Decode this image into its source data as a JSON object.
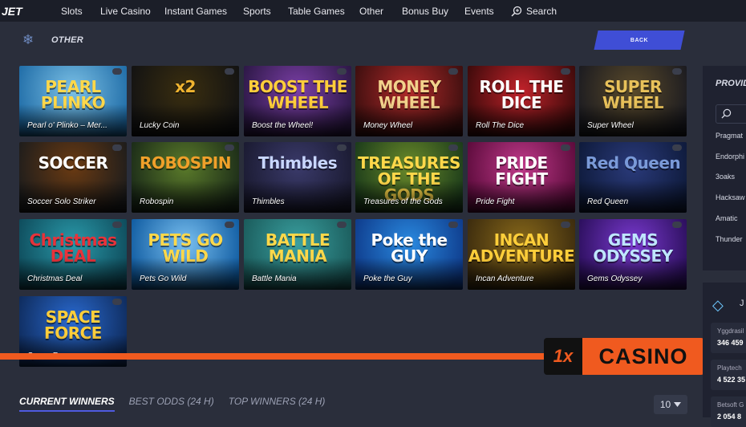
{
  "nav": {
    "logo": "JET",
    "items": [
      "Slots",
      "Live Casino",
      "Instant Games",
      "Sports",
      "Table Games",
      "Other",
      "Bonus Buy",
      "Events"
    ],
    "search_label": "Search"
  },
  "section": {
    "title": "OTHER",
    "back_label": "BACK",
    "icon": "snowflake-icon"
  },
  "games": [
    {
      "name": "Pearl o' Plinko – Mer...",
      "art": "PEARL PLINKO",
      "bg1": "#1e6ba6",
      "bg2": "#7cc1e6",
      "fg": "#ffd84a"
    },
    {
      "name": "Lucky Coin",
      "art": "x2",
      "bg1": "#121212",
      "bg2": "#3a2e10",
      "fg": "#f0b430"
    },
    {
      "name": "Boost the Wheel!",
      "art": "BOOST THE WHEEL",
      "bg1": "#2b1744",
      "bg2": "#7b3fa6",
      "fg": "#ffce3a"
    },
    {
      "name": "Money Wheel",
      "art": "MONEY WHEEL",
      "bg1": "#3a0e0e",
      "bg2": "#b02a2a",
      "fg": "#f2d28c"
    },
    {
      "name": "Roll The Dice",
      "art": "ROLL THE DICE",
      "bg1": "#3a0a0a",
      "bg2": "#c0222a",
      "fg": "#ffffff"
    },
    {
      "name": "Super Wheel",
      "art": "SUPER WHEEL",
      "bg1": "#1a1a20",
      "bg2": "#5a4a2a",
      "fg": "#e8c15a"
    },
    {
      "name": "Soccer Solo Striker",
      "art": "SOCCER",
      "bg1": "#1c1c1c",
      "bg2": "#6a3a12",
      "fg": "#ffffff"
    },
    {
      "name": "Robospin",
      "art": "ROBOSPIN",
      "bg1": "#1a2a18",
      "bg2": "#5a7a2a",
      "fg": "#f0a02a"
    },
    {
      "name": "Thimbles",
      "art": "Thimbles",
      "bg1": "#1a1a30",
      "bg2": "#3a3a6a",
      "fg": "#c8d6ff"
    },
    {
      "name": "Treasures of the Gods",
      "art": "TREASURES OF THE GODS",
      "bg1": "#1a3a1a",
      "bg2": "#6a8a2a",
      "fg": "#ffd84a"
    },
    {
      "name": "Pride Fight",
      "art": "PRIDE FIGHT",
      "bg1": "#5a0a3a",
      "bg2": "#c03a8a",
      "fg": "#ffffff"
    },
    {
      "name": "Red Queen",
      "art": "Red Queen",
      "bg1": "#0e1a3a",
      "bg2": "#2a3a7a",
      "fg": "#7a9ad8"
    },
    {
      "name": "Christmas Deal",
      "art": "Christmas DEAL",
      "bg1": "#0e4a5a",
      "bg2": "#2a9aaa",
      "fg": "#e8323a"
    },
    {
      "name": "Pets Go Wild",
      "art": "PETS GO WILD",
      "bg1": "#0e5aa0",
      "bg2": "#7ac0f0",
      "fg": "#ffd84a"
    },
    {
      "name": "Battle Mania",
      "art": "BATTLE MANIA",
      "bg1": "#1a5a5a",
      "bg2": "#3aa0a0",
      "fg": "#ffd84a"
    },
    {
      "name": "Poke the Guy",
      "art": "Poke the GUY",
      "bg1": "#0e3a8a",
      "bg2": "#2a8ae0",
      "fg": "#ffffff"
    },
    {
      "name": "Incan Adventure",
      "art": "INCAN ADVENTURE",
      "bg1": "#3a2a0e",
      "bg2": "#8a6a1a",
      "fg": "#ffce3a"
    },
    {
      "name": "Gems Odyssey",
      "art": "GEMS ODYSSEY",
      "bg1": "#2a0e5a",
      "bg2": "#7a3ad0",
      "fg": "#bfe6ff"
    },
    {
      "name": "Space Force",
      "art": "SPACE FORCE",
      "bg1": "#0e2a5a",
      "bg2": "#2a6ad0",
      "fg": "#ffce3a"
    }
  ],
  "tabs": [
    "CURRENT WINNERS",
    "BEST ODDS (24 H)",
    "TOP WINNERS (24 H)"
  ],
  "per_page": "10",
  "providers": {
    "title": "PROVID",
    "items": [
      "Pragmat",
      "Endorphi",
      "3oaks",
      "Hacksaw",
      "Amatic",
      "Thunder"
    ]
  },
  "jackpots": {
    "title": "J",
    "rows": [
      {
        "provider": "Yggdrasil",
        "value": "346 459"
      },
      {
        "provider": "Playtech",
        "value": "4 522 35"
      },
      {
        "provider": "Betsoft G",
        "value": "2 054 8"
      }
    ]
  },
  "casino_banner": {
    "mark": "1x",
    "word": "CASINO"
  }
}
